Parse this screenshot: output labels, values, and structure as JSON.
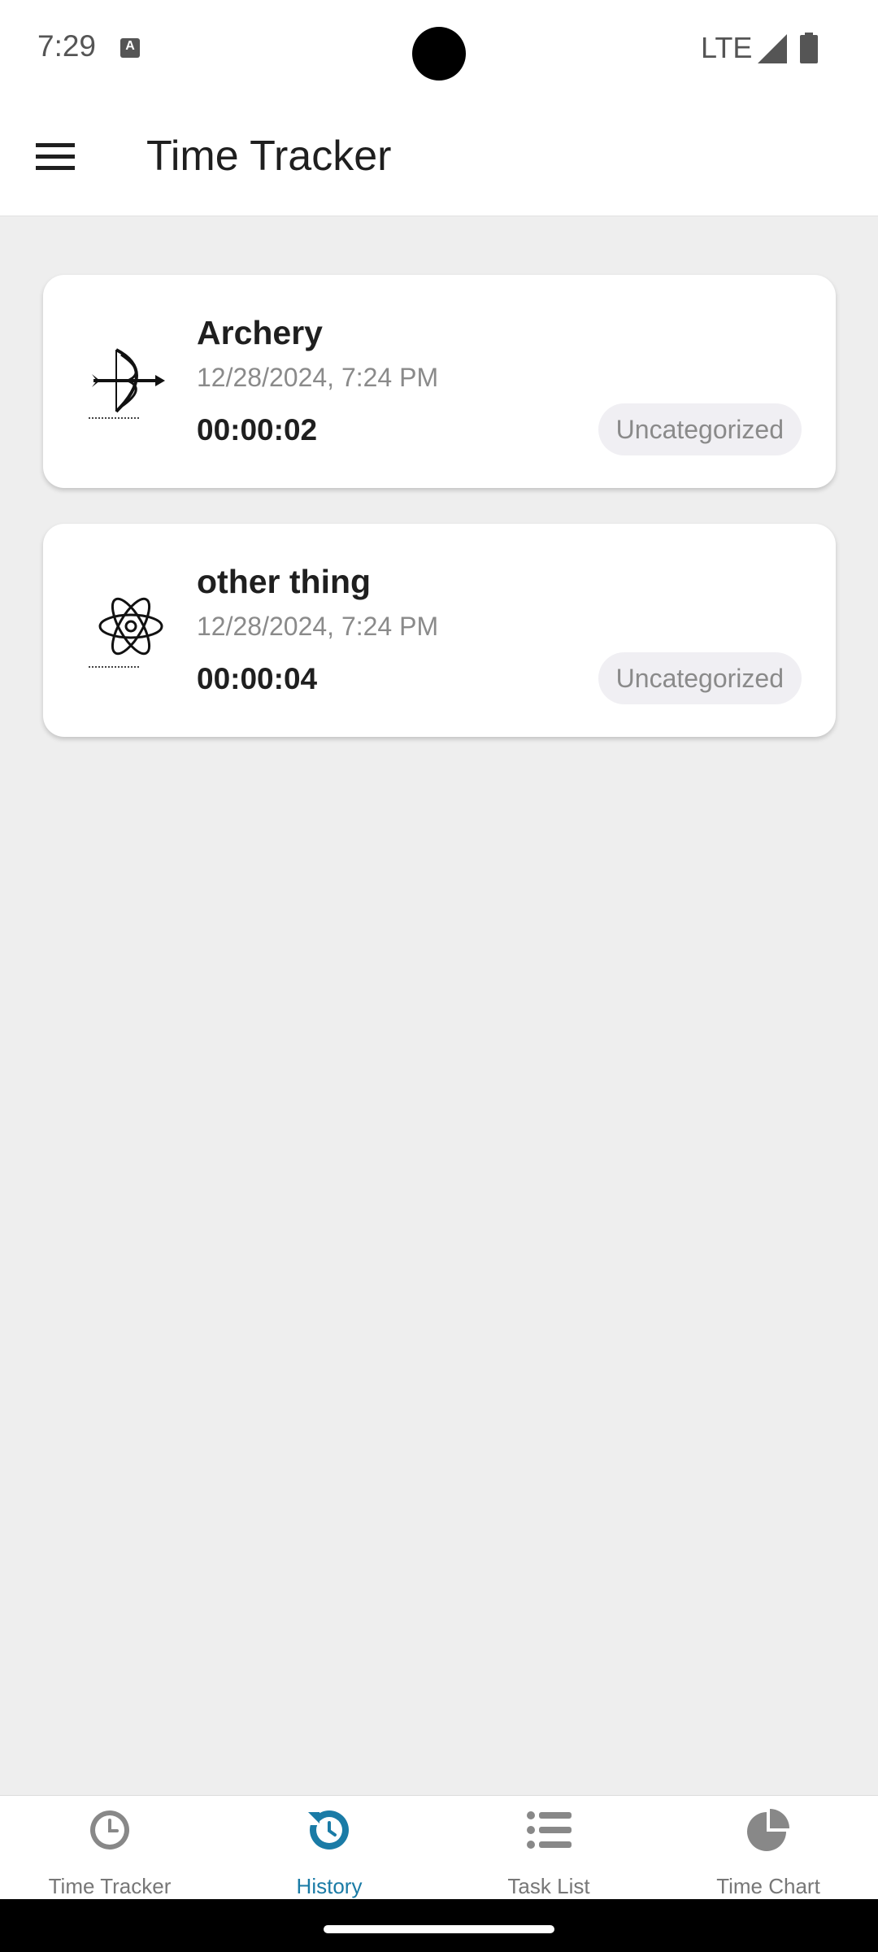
{
  "status": {
    "time": "7:29",
    "network": "LTE"
  },
  "app_bar": {
    "title": "Time Tracker"
  },
  "entries": [
    {
      "name": "Archery",
      "date": "12/28/2024, 7:24 PM",
      "duration": "00:00:02",
      "category": "Uncategorized",
      "icon": "bow-and-arrow-icon"
    },
    {
      "name": "other thing",
      "date": "12/28/2024, 7:24 PM",
      "duration": "00:00:04",
      "category": "Uncategorized",
      "icon": "atom-icon"
    }
  ],
  "bottom_nav": {
    "items": [
      {
        "label": "Time Tracker",
        "icon": "clock-icon"
      },
      {
        "label": "History",
        "icon": "history-icon",
        "active": true
      },
      {
        "label": "Task List",
        "icon": "list-icon"
      },
      {
        "label": "Time Chart",
        "icon": "pie-chart-icon"
      }
    ]
  },
  "colors": {
    "accent": "#1a7ba6",
    "background": "#eeeeee",
    "card": "#ffffff"
  }
}
